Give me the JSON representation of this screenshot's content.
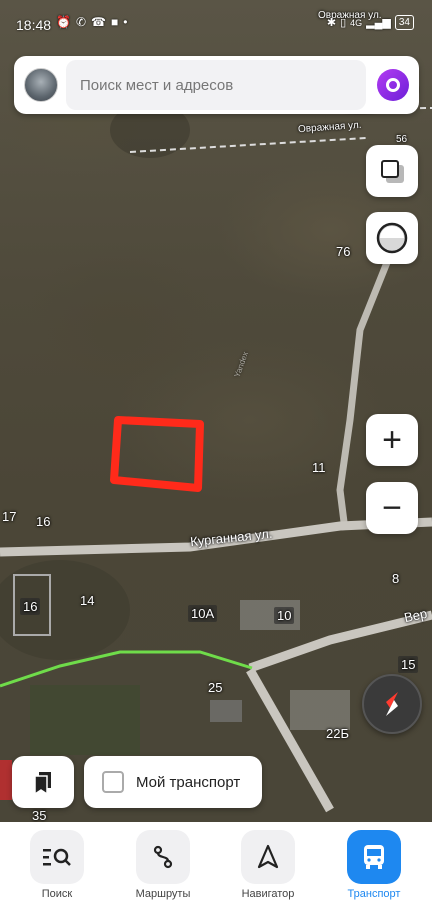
{
  "status_bar": {
    "time": "18:48",
    "battery": "34",
    "network": "4G"
  },
  "search": {
    "placeholder": "Поиск мест и адресов"
  },
  "map": {
    "street_labels": [
      "Овражная ул.",
      "Овражная ул.",
      "Курганная ул.",
      "Вер"
    ],
    "house_numbers": [
      "76",
      "11",
      "17",
      "16",
      "16",
      "14",
      "10А",
      "10",
      "8",
      "25",
      "15",
      "22Б",
      "35",
      "56"
    ],
    "watermark": "Yandex"
  },
  "buttons": {
    "zoom_in": "+",
    "zoom_out": "−",
    "my_transport": "Мой транспорт"
  },
  "tabs": [
    {
      "label": "Поиск",
      "icon": "search-list-icon",
      "active": false
    },
    {
      "label": "Маршруты",
      "icon": "route-icon",
      "active": false
    },
    {
      "label": "Навигатор",
      "icon": "navigator-arrow-icon",
      "active": false
    },
    {
      "label": "Транспорт",
      "icon": "bus-icon",
      "active": true
    }
  ],
  "colors": {
    "accent": "#1e88f0",
    "alice": "#8a2be2",
    "drawn_marker": "#ff2a1a",
    "route_green": "#6fdc4a"
  }
}
